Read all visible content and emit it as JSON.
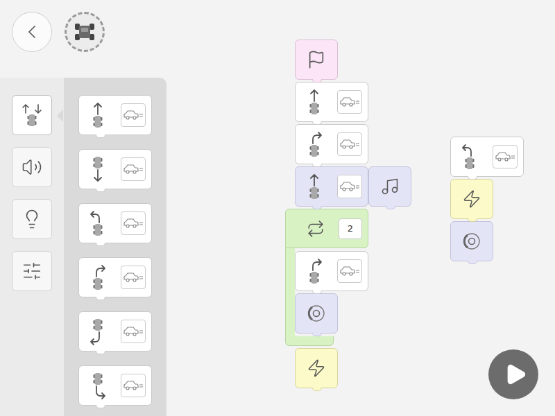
{
  "categories": [
    {
      "kind": "motion",
      "selected": true
    },
    {
      "kind": "sound",
      "selected": false
    },
    {
      "kind": "light",
      "selected": false
    },
    {
      "kind": "settings",
      "selected": false
    }
  ],
  "palette": [
    {
      "kind": "forward"
    },
    {
      "kind": "backward"
    },
    {
      "kind": "turn-left"
    },
    {
      "kind": "turn-right"
    },
    {
      "kind": "back-left"
    },
    {
      "kind": "back-right"
    }
  ],
  "scripts": [
    {
      "blocks": [
        {
          "kind": "start"
        },
        {
          "kind": "forward"
        },
        {
          "kind": "turn-right"
        },
        {
          "kind": "forward",
          "sound": true
        },
        {
          "kind": "repeat",
          "count": "2",
          "blocks": [
            {
              "kind": "turn-right"
            },
            {
              "kind": "brake"
            }
          ]
        },
        {
          "kind": "flash"
        }
      ]
    },
    {
      "blocks": [
        {
          "kind": "turn-left"
        },
        {
          "kind": "flash"
        },
        {
          "kind": "brake"
        }
      ]
    }
  ]
}
